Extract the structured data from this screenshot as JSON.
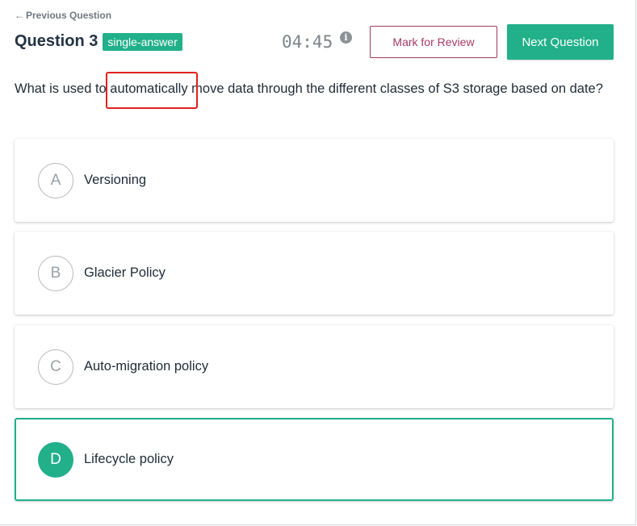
{
  "nav": {
    "previous_arrow": "←",
    "previous_label": "Previous Question"
  },
  "header": {
    "question_title": "Question 3",
    "question_type": "single-answer",
    "timer": "04:45",
    "info_glyph": "i",
    "mark_review_label": "Mark for Review",
    "next_label": "Next Question"
  },
  "question": {
    "text": "What is used to automatically move data through the different classes of S3 storage based on date?"
  },
  "options": [
    {
      "letter": "A",
      "label": "Versioning",
      "selected": false
    },
    {
      "letter": "B",
      "label": "Glacier Policy",
      "selected": false
    },
    {
      "letter": "C",
      "label": "Auto-migration policy",
      "selected": false
    },
    {
      "letter": "D",
      "label": "Lifecycle policy",
      "selected": true
    }
  ],
  "colors": {
    "accent": "#21b08a",
    "review": "#a43a63",
    "highlight": "#e0201f"
  },
  "icons": {
    "previous": "arrow-left-icon",
    "info": "info-icon"
  }
}
